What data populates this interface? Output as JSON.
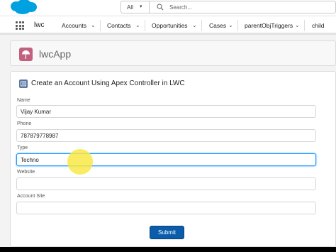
{
  "header": {
    "search": {
      "scope": "All",
      "placeholder": "Search..."
    }
  },
  "nav": {
    "app_name": "lwc",
    "items": [
      {
        "label": "Accounts"
      },
      {
        "label": "Contacts"
      },
      {
        "label": "Opportunities"
      },
      {
        "label": "Cases"
      },
      {
        "label": "parentObjTriggers"
      },
      {
        "label": "child"
      }
    ]
  },
  "page": {
    "title": "lwcApp"
  },
  "card": {
    "title": "Create an Account Using Apex Controller in LWC",
    "fields": [
      {
        "label": "Name",
        "value": "Vijay Kumar"
      },
      {
        "label": "Phone",
        "value": "787879778987"
      },
      {
        "label": "Type",
        "value": "Techno"
      },
      {
        "label": "Website",
        "value": ""
      },
      {
        "label": "Account Site",
        "value": ""
      }
    ],
    "submit_label": "Submit"
  },
  "colors": {
    "brand_cloud": "#00a1e0",
    "submit_button": "#0b5cab",
    "app_icon": "#c2607f",
    "focus_ring": "#1b96ff"
  }
}
